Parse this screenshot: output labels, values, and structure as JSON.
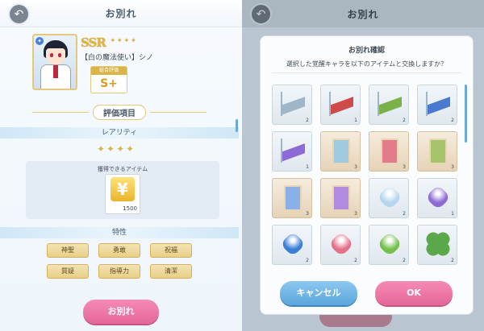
{
  "left": {
    "header": {
      "title": "お別れ"
    },
    "character": {
      "rarity": "SSR",
      "stars": "✦✦✦✦",
      "name": "【白の魔法使い】シノ"
    },
    "evaluation": {
      "label": "総合評価",
      "grade": "S+"
    },
    "section_title": "評価項目",
    "rarity_band": "レアリティ",
    "rarity_stars": "✦✦✦✦",
    "obtain": {
      "label": "獲得できるアイテム",
      "item_icon": "¥",
      "count": "1500"
    },
    "traits_band": "特性",
    "traits": [
      "神聖",
      "勇敢",
      "祝福",
      "質疑",
      "指導力",
      "清潔"
    ],
    "farewell_button": "お別れ"
  },
  "right": {
    "header": {
      "title": "お別れ"
    },
    "dialog": {
      "title": "お別れ確認",
      "subtitle": "選択した覚醒キャラを以下のアイテムと交換しますか？",
      "items": [
        {
          "kind": "ice",
          "count": "2",
          "color": "#9fb6c8"
        },
        {
          "kind": "ice",
          "count": "1",
          "color": "#d04a4a"
        },
        {
          "kind": "ice",
          "count": "2",
          "color": "#7ab24a"
        },
        {
          "kind": "ice",
          "count": "2",
          "color": "#4a7ad0"
        },
        {
          "kind": "ice",
          "count": "1",
          "color": "#8e6ad6"
        },
        {
          "kind": "card",
          "count": "3",
          "color": "#9fcbe0"
        },
        {
          "kind": "card",
          "count": "3",
          "color": "#e37a8a"
        },
        {
          "kind": "card",
          "count": "3",
          "color": "#a6c46a"
        },
        {
          "kind": "card",
          "count": "3",
          "color": "#8ab0e8"
        },
        {
          "kind": "card",
          "count": "3",
          "color": "#b28ae0"
        },
        {
          "kind": "gem",
          "count": "2",
          "color": "#b6d6ee"
        },
        {
          "kind": "gem",
          "count": "1",
          "color": "#8e6ad6"
        },
        {
          "kind": "gem",
          "count": "2",
          "color": "#3a7fd6"
        },
        {
          "kind": "gem",
          "count": "2",
          "color": "#e6708a"
        },
        {
          "kind": "gem",
          "count": "2",
          "color": "#74c04a"
        },
        {
          "kind": "clover",
          "count": "2",
          "color": "#5aa84a"
        }
      ],
      "cancel_label": "キャンセル",
      "ok_label": "OK"
    }
  }
}
